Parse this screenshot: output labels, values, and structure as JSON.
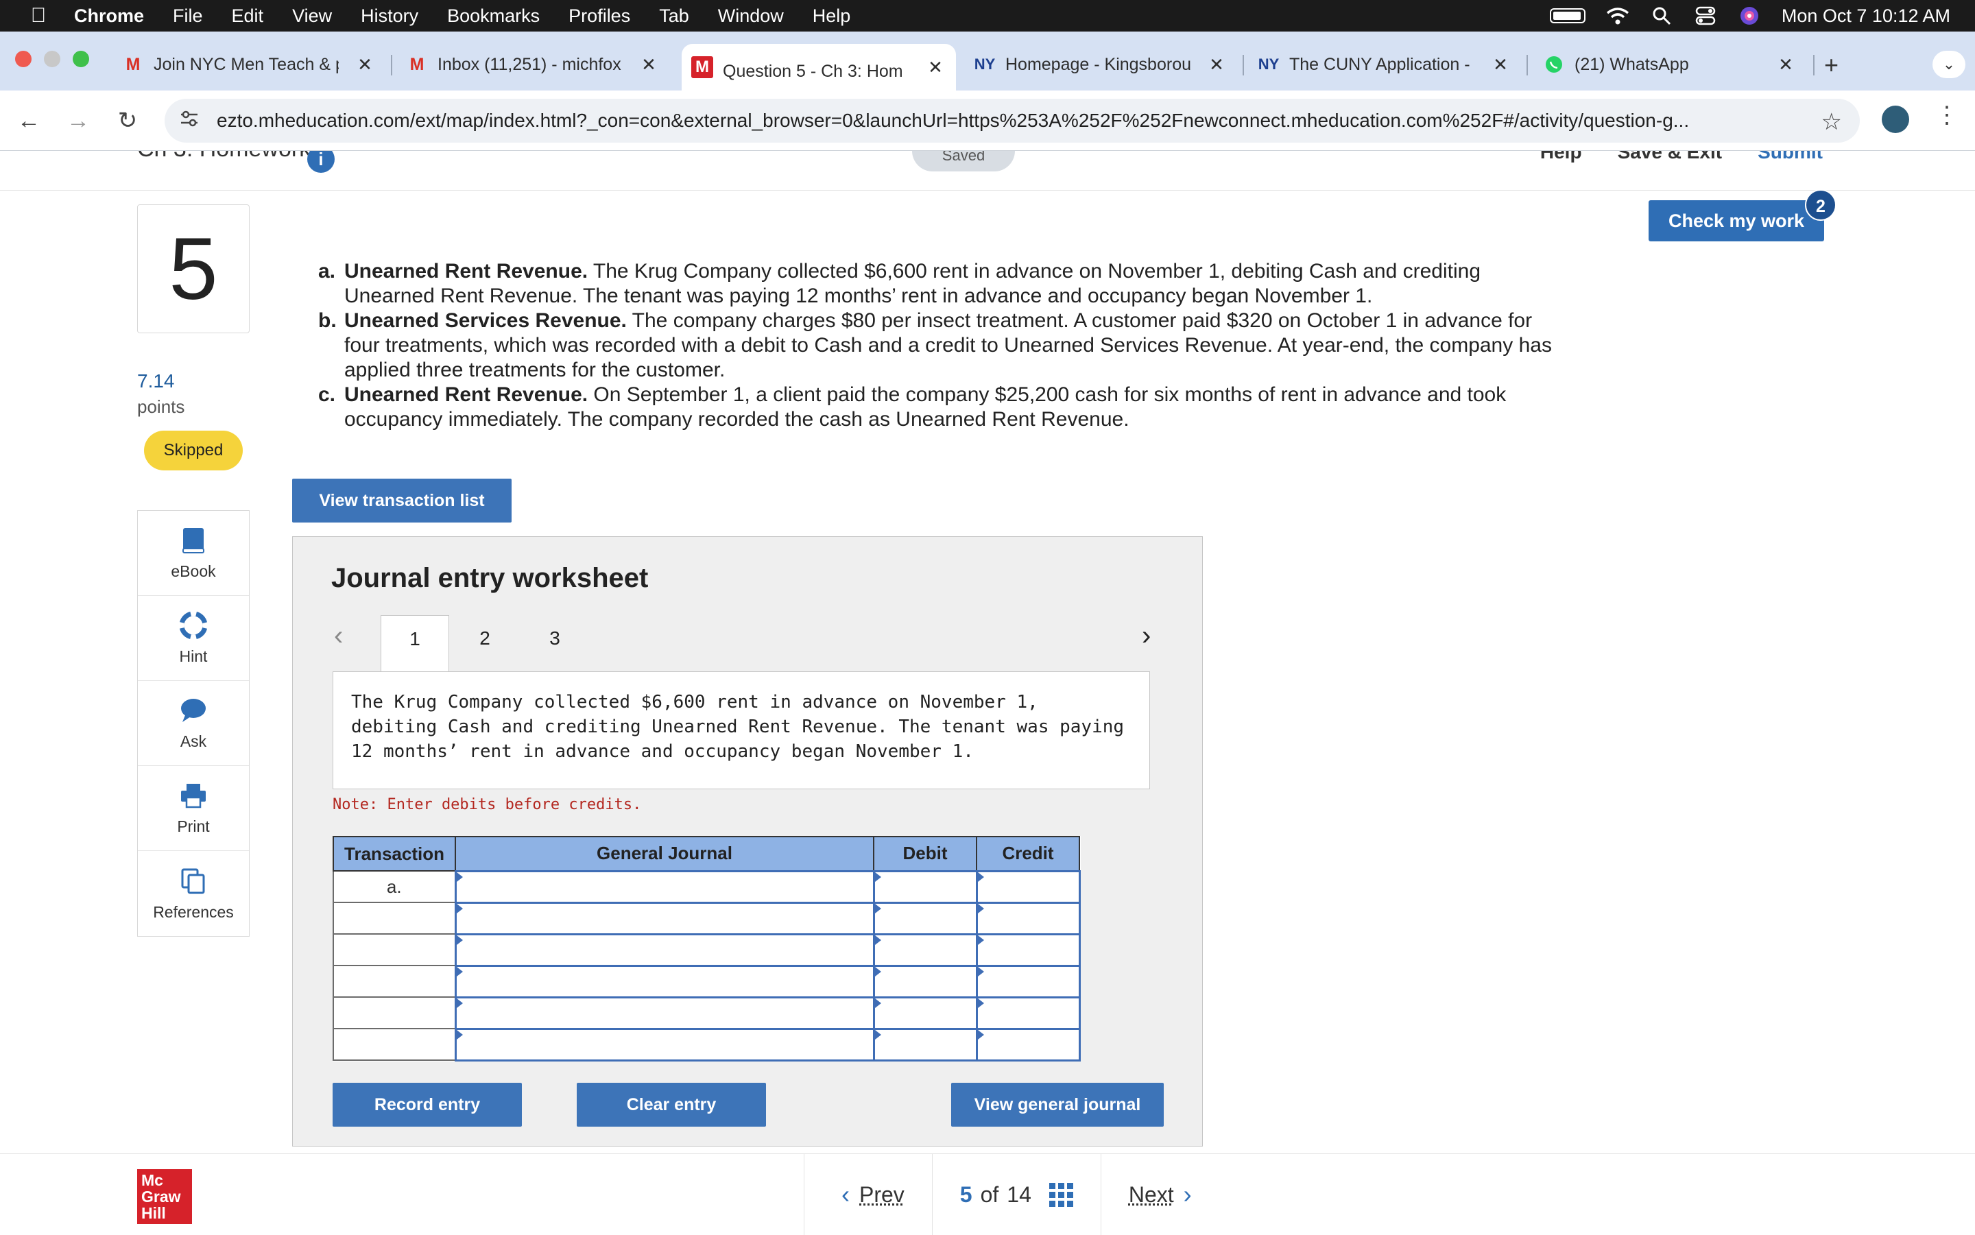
{
  "menubar": {
    "app": "Chrome",
    "items": [
      "File",
      "Edit",
      "View",
      "History",
      "Bookmarks",
      "Profiles",
      "Tab",
      "Window",
      "Help"
    ],
    "clock": "Mon Oct 7  10:12 AM"
  },
  "tabs": [
    {
      "title": "Join NYC Men Teach & p",
      "favicon": "gmail-icon"
    },
    {
      "title": "Inbox (11,251) - michfox",
      "favicon": "gmail-icon"
    },
    {
      "title": "Question 5 - Ch 3: Hom",
      "favicon": "mheducation-icon",
      "active": true
    },
    {
      "title": "Homepage - Kingsborou",
      "favicon": "cuny-icon"
    },
    {
      "title": "The CUNY Application -",
      "favicon": "cuny-icon"
    },
    {
      "title": "(21) WhatsApp",
      "favicon": "whatsapp-icon"
    }
  ],
  "toolbar": {
    "url": "ezto.mheducation.com/ext/map/index.html?_con=con&external_browser=0&launchUrl=https%253A%252F%252Fnewconnect.mheducation.com%252F#/activity/question-g..."
  },
  "header": {
    "assignment": "Ch 3: Homework",
    "saved": "Saved",
    "help": "Help",
    "save_exit": "Save & Exit",
    "submit": "Submit"
  },
  "question": {
    "number": "5",
    "points_value": "7.14",
    "points_label": "points",
    "status": "Skipped",
    "items": [
      {
        "letter": "a.",
        "heading": "Unearned Rent Revenue.",
        "text": " The Krug Company collected $6,600 rent in advance on November 1, debiting Cash and crediting Unearned Rent Revenue. The tenant was paying 12 months’ rent in advance and occupancy began November 1."
      },
      {
        "letter": "b.",
        "heading": "Unearned Services Revenue.",
        "text": " The company charges $80 per insect treatment. A customer paid $320 on October 1 in advance for four treatments, which was recorded with a debit to Cash and a credit to Unearned Services Revenue. At year-end, the company has applied three treatments for the customer."
      },
      {
        "letter": "c.",
        "heading": "Unearned Rent Revenue.",
        "text": " On September 1, a client paid the company $25,200 cash for six months of rent in advance and took occupancy immediately. The company recorded the cash as Unearned Rent Revenue."
      }
    ]
  },
  "tools": [
    "eBook",
    "Hint",
    "Ask",
    "Print",
    "References"
  ],
  "check_work": {
    "label": "Check my work",
    "badge": "2"
  },
  "view_transaction_list": "View transaction list",
  "worksheet": {
    "title": "Journal entry worksheet",
    "tabs": [
      "1",
      "2",
      "3"
    ],
    "description": "The Krug Company collected $6,600 rent in advance on November 1, debiting Cash and crediting Unearned Rent Revenue. The tenant was paying 12 months’ rent in advance and occupancy began November 1.",
    "note": "Note: Enter debits before credits.",
    "columns": [
      "Transaction",
      "General Journal",
      "Debit",
      "Credit"
    ],
    "rows": [
      {
        "transaction": "a."
      },
      {
        "transaction": ""
      },
      {
        "transaction": ""
      },
      {
        "transaction": ""
      },
      {
        "transaction": ""
      },
      {
        "transaction": ""
      }
    ],
    "buttons": {
      "record": "Record entry",
      "clear": "Clear entry",
      "view_journal": "View general journal"
    }
  },
  "footer": {
    "logo": [
      "Mc",
      "Graw",
      "Hill"
    ],
    "prev": "Prev",
    "current": "5",
    "of": "of",
    "total": "14",
    "next": "Next"
  }
}
